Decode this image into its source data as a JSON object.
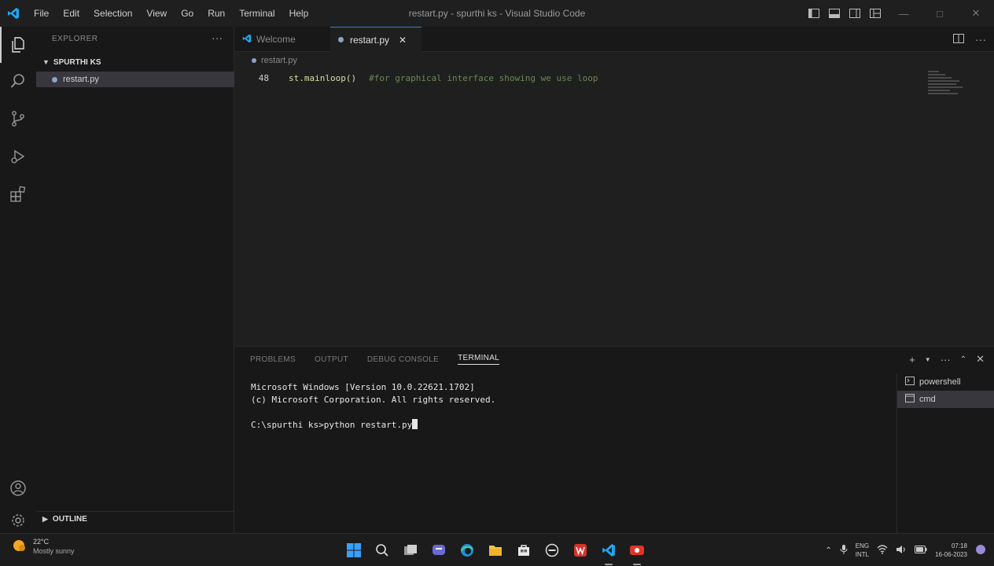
{
  "titlebar": {
    "menu": [
      "File",
      "Edit",
      "Selection",
      "View",
      "Go",
      "Run",
      "Terminal",
      "Help"
    ],
    "title": "restart.py - spurthi ks - Visual Studio Code"
  },
  "sidebar": {
    "header": "EXPLORER",
    "folder": "SPURTHI KS",
    "file": "restart.py",
    "outline": "OUTLINE"
  },
  "tabs": [
    {
      "label": "Welcome"
    },
    {
      "label": "restart.py"
    }
  ],
  "editor": {
    "breadcrumb": "restart.py",
    "line_number": "48",
    "code": "st.mainloop()",
    "comment": "#for graphical interface showing we use loop"
  },
  "panel": {
    "tabs": [
      "PROBLEMS",
      "OUTPUT",
      "DEBUG CONSOLE",
      "TERMINAL"
    ],
    "terminal_lines": [
      "Microsoft Windows [Version 10.0.22621.1702]",
      "(c) Microsoft Corporation. All rights reserved.",
      "",
      "C:\\spurthi ks>python restart.py"
    ],
    "terminals": [
      "powershell",
      "cmd"
    ]
  },
  "taskbar": {
    "temperature": "22°C",
    "weather": "Mostly sunny",
    "lang_top": "ENG",
    "lang_bottom": "INTL",
    "time": "07:18",
    "date": "16-06-2023"
  },
  "colors": {
    "accent": "#3a7bd5",
    "vscode_blue": "#22a6f2",
    "code_comment": "#6a8759"
  }
}
